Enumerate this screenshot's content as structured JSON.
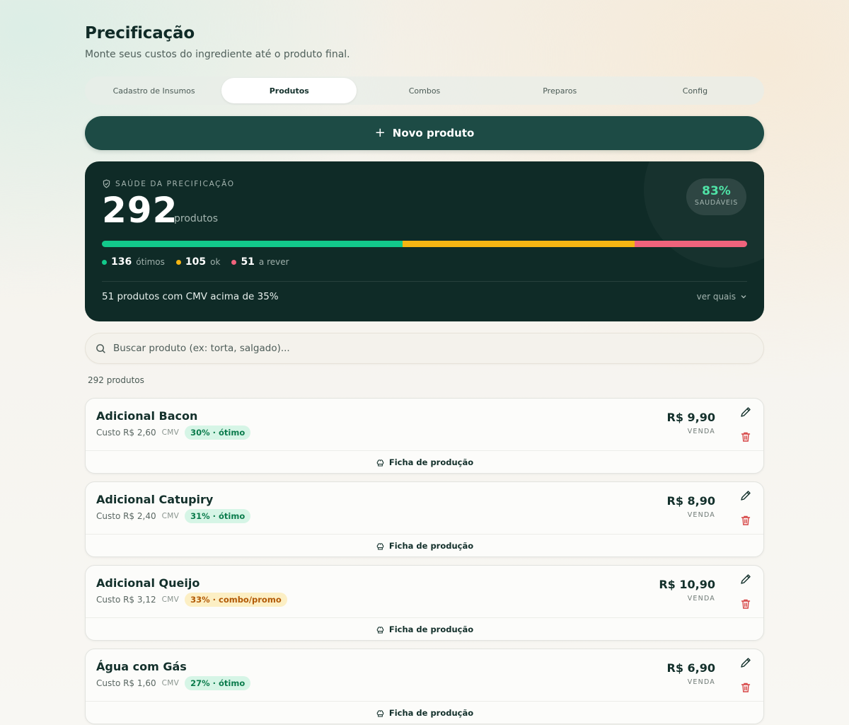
{
  "header": {
    "title": "Precificação",
    "subtitle": "Monte seus custos do ingrediente até o produto final."
  },
  "tabs": [
    {
      "label": "Cadastro de Insumos",
      "active": false
    },
    {
      "label": "Produtos",
      "active": true
    },
    {
      "label": "Combos",
      "active": false
    },
    {
      "label": "Preparos",
      "active": false
    },
    {
      "label": "Config",
      "active": false
    }
  ],
  "new_product": {
    "label": "Novo produto"
  },
  "health": {
    "label": "SAÚDE DA PRECIFICAÇÃO",
    "count": "292",
    "unit": "produtos",
    "percent": "83%",
    "percent_label": "SAUDÁVEIS",
    "segments": [
      {
        "key": "otimos",
        "count": 136,
        "color": "#12c98b"
      },
      {
        "key": "ok",
        "count": 105,
        "color": "#f5b513"
      },
      {
        "key": "rever",
        "count": 51,
        "color": "#f0637c"
      }
    ],
    "legend": [
      {
        "value": "136",
        "label": "ótimos",
        "color": "#12c98b"
      },
      {
        "value": "105",
        "label": "ok",
        "color": "#f5b513"
      },
      {
        "value": "51",
        "label": "a rever",
        "color": "#f0637c"
      }
    ],
    "warning": "51 produtos com CMV acima de 35%",
    "see_which": "ver quais"
  },
  "search": {
    "placeholder": "Buscar produto (ex: torta, salgado)...",
    "value": ""
  },
  "product_count": "292 produtos",
  "colors": {
    "accent": "#1d4b45",
    "dark_card": "#0f2b27",
    "delete": "#d64545"
  },
  "products": [
    {
      "name": "Adicional Bacon",
      "cost": "Custo R$ 2,60",
      "cmv_label": "CMV",
      "badge": "30% · ótimo",
      "badge_type": "green",
      "price": "R$ 9,90",
      "price_label": "VENDA",
      "sheet_label": "Ficha de produção"
    },
    {
      "name": "Adicional Catupiry",
      "cost": "Custo R$ 2,40",
      "cmv_label": "CMV",
      "badge": "31% · ótimo",
      "badge_type": "green",
      "price": "R$ 8,90",
      "price_label": "VENDA",
      "sheet_label": "Ficha de produção"
    },
    {
      "name": "Adicional Queijo",
      "cost": "Custo R$ 3,12",
      "cmv_label": "CMV",
      "badge": "33% · combo/promo",
      "badge_type": "yellow",
      "price": "R$ 10,90",
      "price_label": "VENDA",
      "sheet_label": "Ficha de produção"
    },
    {
      "name": "Água com Gás",
      "cost": "Custo R$ 1,60",
      "cmv_label": "CMV",
      "badge": "27% · ótimo",
      "badge_type": "green",
      "price": "R$ 6,90",
      "price_label": "VENDA",
      "sheet_label": "Ficha de produção"
    }
  ]
}
